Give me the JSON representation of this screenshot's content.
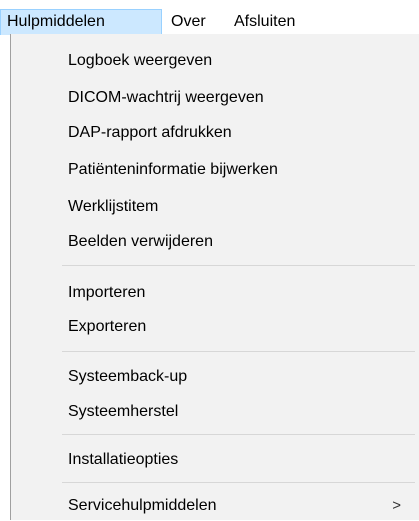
{
  "menubar": {
    "items": [
      {
        "label": "Hulpmiddelen"
      },
      {
        "label": "Over"
      },
      {
        "label": "Afsluiten"
      }
    ]
  },
  "dropdown": {
    "items": [
      {
        "label": "Logboek weergeven"
      },
      {
        "label": "DICOM-wachtrij weergeven"
      },
      {
        "label": "DAP-rapport afdrukken"
      },
      {
        "label": "Patiënteninformatie bijwerken"
      },
      {
        "label": "Werklijstitem"
      },
      {
        "label": "Beelden verwijderen"
      },
      {
        "label": "Importeren"
      },
      {
        "label": "Exporteren"
      },
      {
        "label": "Systeemback-up"
      },
      {
        "label": "Systeemherstel"
      },
      {
        "label": "Installatieopties"
      },
      {
        "label": "Servicehulpmiddelen",
        "submenu_arrow": ">"
      }
    ]
  },
  "colors": {
    "active_menu_bg": "#cce8ff",
    "active_menu_border": "#99d1ff",
    "dropdown_bg": "#f2f2f2",
    "separator": "#d7d7d7"
  }
}
